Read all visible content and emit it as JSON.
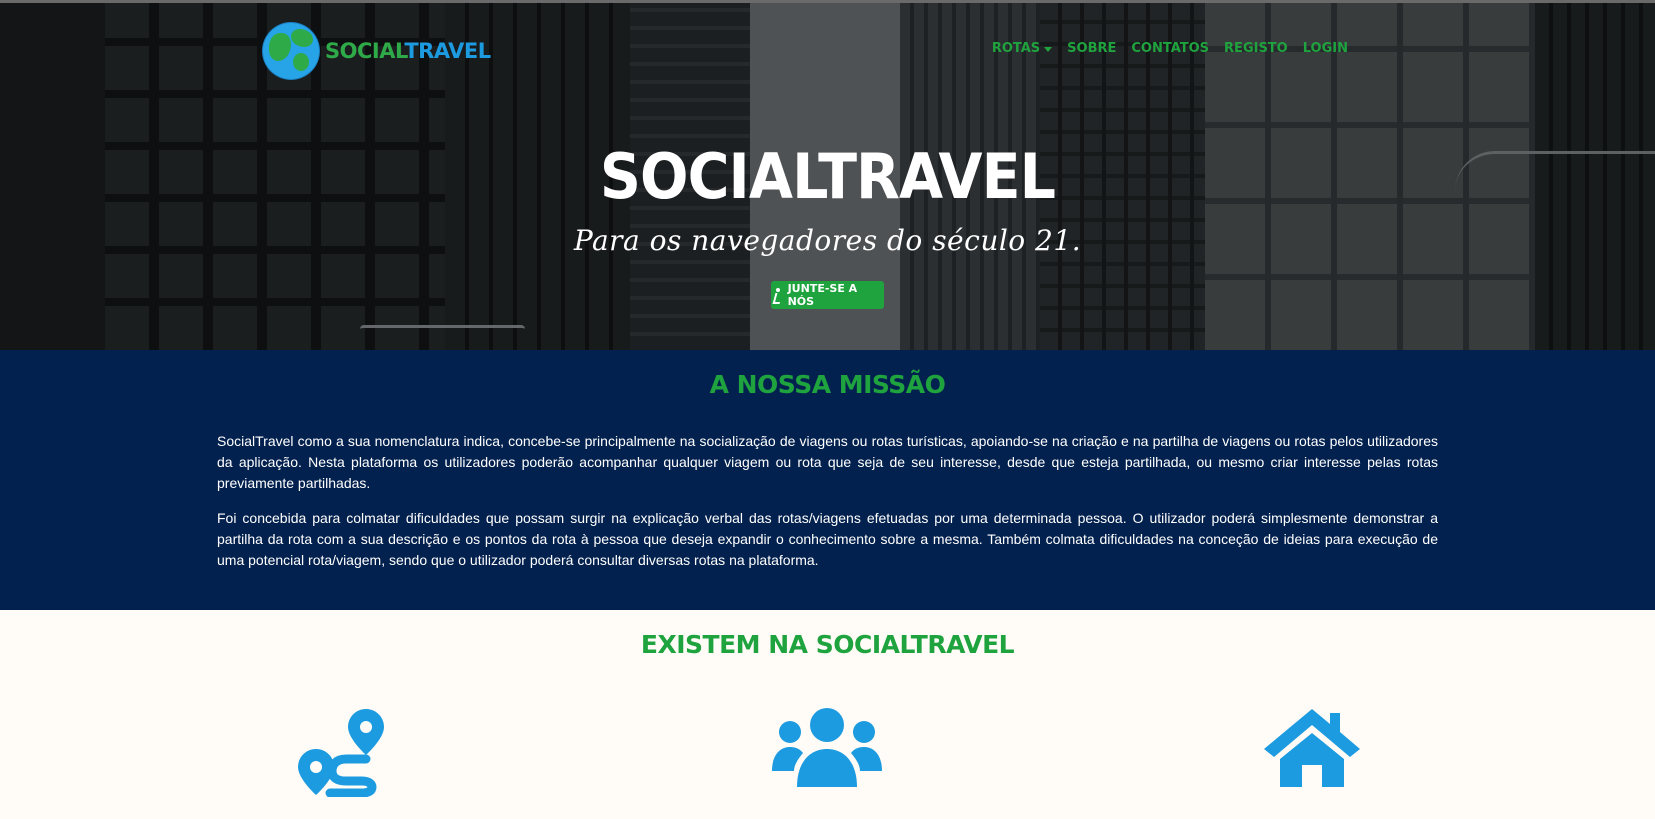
{
  "brand": {
    "name_part1": "SOCIAL",
    "name_part2": "TRAVEL"
  },
  "nav": {
    "items": [
      {
        "label": "ROTAS",
        "dropdown": true
      },
      {
        "label": "SOBRE"
      },
      {
        "label": "CONTATOS"
      },
      {
        "label": "REGISTO"
      },
      {
        "label": "LOGIN"
      }
    ]
  },
  "hero": {
    "title": "SOCIALTRAVEL",
    "subtitle": "Para os navegadores do século 21.",
    "cta_label": "JUNTE-SE A NÓS"
  },
  "mission": {
    "title": "A NOSSA MISSÃO",
    "paragraphs": [
      "SocialTravel como a sua nomenclatura indica, concebe-se principalmente na socialização de viagens ou rotas turísticas, apoiando-se na criação e na partilha de viagens ou rotas pelos utilizadores da aplicação. Nesta plataforma os utilizadores poderão acompanhar qualquer viagem ou rota que seja de seu interesse, desde que esteja partilhada, ou mesmo criar interesse pelas rotas previamente partilhadas.",
      "Foi concebida para colmatar dificuldades que possam surgir na explicação verbal das rotas/viagens efetuadas por uma determinada pessoa. O utilizador poderá simplesmente demonstrar a partilha da rota com a sua descrição e os pontos da rota à pessoa que deseja expandir o conhecimento sobre a mesma. Também colmata dificuldades na conceção de ideias para execução de uma potencial rota/viagem, sendo que o utilizador poderá consultar diversas rotas na plataforma."
    ]
  },
  "features": {
    "title": "EXISTEM NA SOCIALTRAVEL",
    "icons": [
      "route-icon",
      "users-icon",
      "home-icon"
    ]
  },
  "colors": {
    "accent_green": "#1fa33e",
    "navy": "#03214e",
    "icon_blue": "#1d9be0",
    "cream": "#fffcf8"
  }
}
